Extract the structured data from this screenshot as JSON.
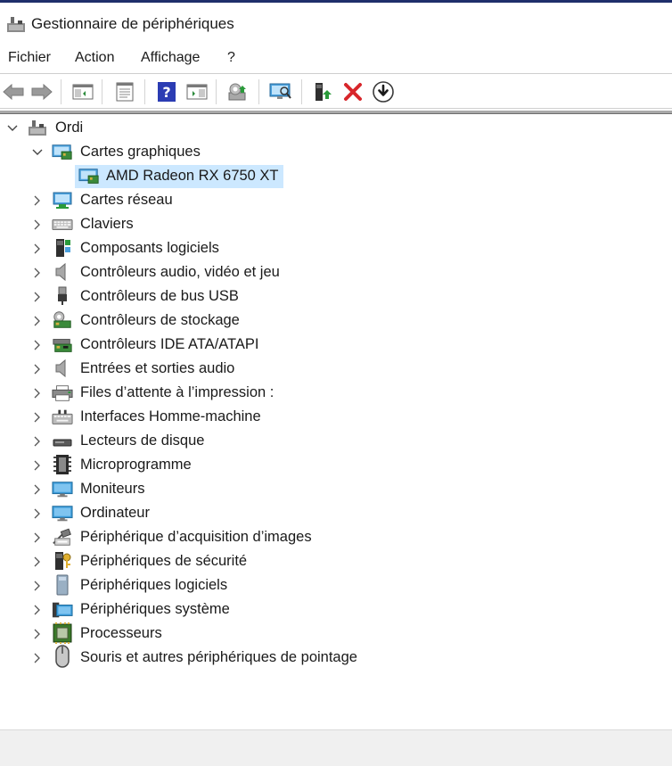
{
  "window": {
    "title": "Gestionnaire de périphériques"
  },
  "menu": {
    "items": [
      "Fichier",
      "Action",
      "Affichage",
      "?"
    ]
  },
  "toolbar": {
    "buttons": [
      "back-icon",
      "forward-icon",
      "show-hide-console-tree-icon",
      "properties-icon",
      "help-icon",
      "export-view-icon",
      "update-driver-icon",
      "scan-hardware-icon",
      "add-driver-icon",
      "uninstall-icon",
      "download-icon"
    ]
  },
  "tree": {
    "root": "Ordi",
    "expanded_category": "Cartes graphiques",
    "selected_device": "AMD Radeon RX 6750 XT",
    "categories": [
      "Cartes réseau",
      "Claviers",
      "Composants logiciels",
      "Contrôleurs audio, vidéo et jeu",
      "Contrôleurs de bus USB",
      "Contrôleurs de stockage",
      "Contrôleurs IDE ATA/ATAPI",
      "Entrées et sorties audio",
      "Files d’attente à l’impression :",
      "Interfaces Homme-machine",
      "Lecteurs de disque",
      "Microprogramme",
      "Moniteurs",
      "Ordinateur",
      "Périphérique d’acquisition d’images",
      "Périphériques de sécurité",
      "Périphériques logiciels",
      "Périphériques système",
      "Processeurs",
      "Souris et autres périphériques de pointage"
    ]
  },
  "colors": {
    "selection": "#cce8ff",
    "uninstall_red": "#d8262b",
    "help_blue": "#2b3cb3"
  }
}
